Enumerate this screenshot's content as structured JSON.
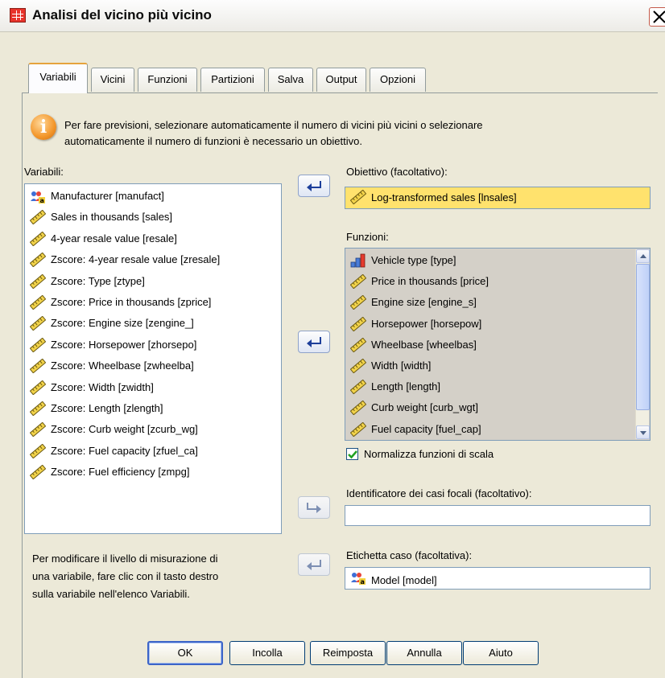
{
  "window": {
    "title": "Analisi del vicino più vicino"
  },
  "tabs": [
    {
      "label": "Variabili",
      "active": true
    },
    {
      "label": "Vicini",
      "active": false
    },
    {
      "label": "Funzioni",
      "active": false
    },
    {
      "label": "Partizioni",
      "active": false
    },
    {
      "label": "Salva",
      "active": false
    },
    {
      "label": "Output",
      "active": false
    },
    {
      "label": "Opzioni",
      "active": false
    }
  ],
  "info": {
    "line1": "Per fare previsioni, selezionare automaticamente il numero di vicini più vicini o selezionare",
    "line2": "automaticamente il numero di funzioni è necessario un obiettivo."
  },
  "variables": {
    "label": "Variabili:",
    "items": [
      {
        "label": "Manufacturer [manufact]",
        "icon": "nominal-string-icon"
      },
      {
        "label": "Sales in thousands [sales]",
        "icon": "scale-ruler-icon"
      },
      {
        "label": "4-year resale value [resale]",
        "icon": "scale-ruler-icon"
      },
      {
        "label": "Zscore:  4-year resale value [zresale]",
        "icon": "scale-ruler-icon"
      },
      {
        "label": "Zscore:  Type [ztype]",
        "icon": "scale-ruler-icon"
      },
      {
        "label": "Zscore:  Price in thousands [zprice]",
        "icon": "scale-ruler-icon"
      },
      {
        "label": "Zscore:  Engine size [zengine_]",
        "icon": "scale-ruler-icon"
      },
      {
        "label": "Zscore:  Horsepower [zhorsepo]",
        "icon": "scale-ruler-icon"
      },
      {
        "label": "Zscore:  Wheelbase [zwheelba]",
        "icon": "scale-ruler-icon"
      },
      {
        "label": "Zscore:  Width [zwidth]",
        "icon": "scale-ruler-icon"
      },
      {
        "label": "Zscore:  Length [zlength]",
        "icon": "scale-ruler-icon"
      },
      {
        "label": "Zscore:  Curb weight [zcurb_wg]",
        "icon": "scale-ruler-icon"
      },
      {
        "label": "Zscore:  Fuel capacity [zfuel_ca]",
        "icon": "scale-ruler-icon"
      },
      {
        "label": "Zscore:  Fuel efficiency [zmpg]",
        "icon": "scale-ruler-icon"
      }
    ]
  },
  "target": {
    "label": "Obiettivo (facoltativo):",
    "value": "Log-transformed sales [lnsales]",
    "icon": "scale-ruler-icon"
  },
  "features": {
    "label": "Funzioni:",
    "items": [
      {
        "label": "Vehicle type [type]",
        "icon": "nominal-bar-icon"
      },
      {
        "label": "Price in thousands [price]",
        "icon": "scale-ruler-icon"
      },
      {
        "label": "Engine size [engine_s]",
        "icon": "scale-ruler-icon"
      },
      {
        "label": "Horsepower [horsepow]",
        "icon": "scale-ruler-icon"
      },
      {
        "label": "Wheelbase [wheelbas]",
        "icon": "scale-ruler-icon"
      },
      {
        "label": "Width [width]",
        "icon": "scale-ruler-icon"
      },
      {
        "label": "Length [length]",
        "icon": "scale-ruler-icon"
      },
      {
        "label": "Curb weight [curb_wgt]",
        "icon": "scale-ruler-icon"
      },
      {
        "label": "Fuel capacity [fuel_cap]",
        "icon": "scale-ruler-icon"
      }
    ]
  },
  "normalize": {
    "label": "Normalizza funzioni di scala",
    "checked": true
  },
  "focal": {
    "label": "Identificatore dei casi focali (facoltativo):",
    "value": ""
  },
  "case_label": {
    "label": "Etichetta caso (facoltativa):",
    "value": "Model [model]",
    "icon": "nominal-string-icon"
  },
  "help": {
    "line1": "Per modificare il livello di misurazione di",
    "line2": "una variabile, fare clic con il tasto destro",
    "line3": "sulla variabile nell'elenco Variabili."
  },
  "buttons": {
    "ok": "OK",
    "paste": "Incolla",
    "reset": "Reimposta",
    "cancel": "Annulla",
    "help": "Aiuto"
  },
  "colors": {
    "target_field_bg": "#ffe26d",
    "dialog_bg": "#ece9d8",
    "tab_accent": "#e6a33c"
  }
}
